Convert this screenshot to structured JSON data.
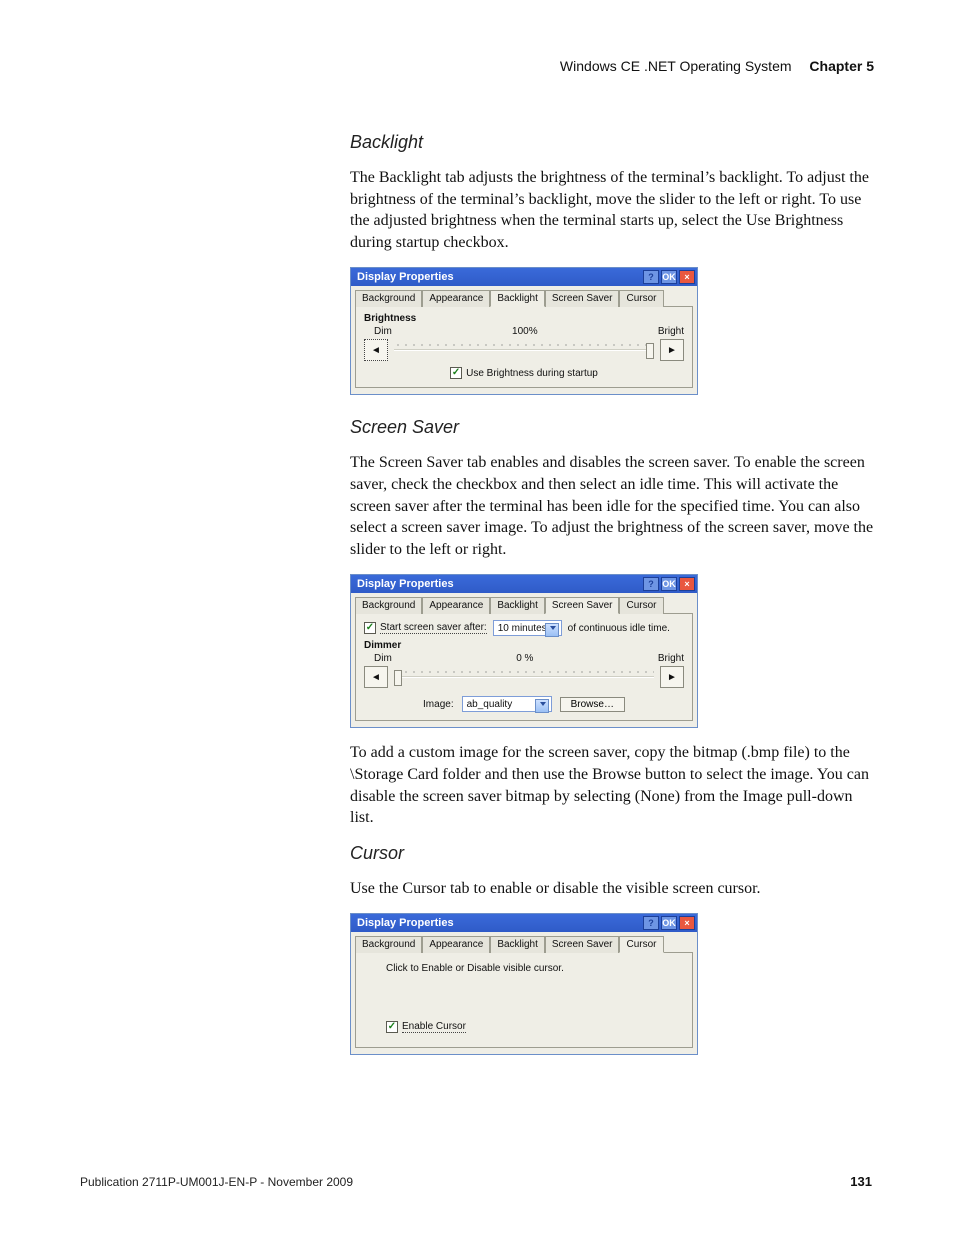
{
  "header": {
    "section": "Windows CE .NET Operating System",
    "chapter": "Chapter 5"
  },
  "backlight": {
    "heading": "Backlight",
    "para": "The Backlight tab adjusts the brightness of the terminal’s backlight. To adjust the brightness of the terminal’s backlight, move the slider to the left or right. To use the adjusted brightness when the terminal starts up, select the Use Brightness during startup checkbox.",
    "dlg": {
      "title": "Display Properties",
      "help": "?",
      "ok": "OK",
      "close": "×",
      "tabs": [
        "Background",
        "Appearance",
        "Backlight",
        "Screen Saver",
        "Cursor"
      ],
      "active_tab": 2,
      "group_label": "Brightness",
      "dim_label": "Dim",
      "bright_label": "Bright",
      "percent": "100%",
      "left_arrow": "◄",
      "right_arrow": "►",
      "checkbox_label": "Use Brightness during startup"
    }
  },
  "screensaver": {
    "heading": "Screen Saver",
    "para1": "The Screen Saver tab enables and disables the screen saver. To enable the screen saver, check the checkbox and then select an idle time. This will activate the screen saver after the terminal has been idle for the specified time. You can also select a screen saver image. To adjust the brightness of the screen saver, move the slider to the left or right.",
    "para2": "To add a custom image for the screen saver, copy the bitmap (.bmp file) to the \\Storage Card folder and then use the Browse button to select the image. You can disable the screen saver bitmap by selecting (None) from the Image pull-down list.",
    "dlg": {
      "title": "Display Properties",
      "help": "?",
      "ok": "OK",
      "close": "×",
      "tabs": [
        "Background",
        "Appearance",
        "Backlight",
        "Screen Saver",
        "Cursor"
      ],
      "active_tab": 3,
      "start_label": "Start screen saver after:",
      "idle_value": "10 minutes",
      "idle_suffix": "of continuous idle time.",
      "group_label": "Dimmer",
      "dim_label": "Dim",
      "bright_label": "Bright",
      "percent": "0 %",
      "left_arrow": "◄",
      "right_arrow": "►",
      "image_label": "Image:",
      "image_value": "ab_quality",
      "browse": "Browse…"
    }
  },
  "cursor": {
    "heading": "Cursor",
    "para": "Use the Cursor tab to enable or disable the visible screen cursor.",
    "dlg": {
      "title": "Display Properties",
      "help": "?",
      "ok": "OK",
      "close": "×",
      "tabs": [
        "Background",
        "Appearance",
        "Backlight",
        "Screen Saver",
        "Cursor"
      ],
      "active_tab": 4,
      "instruction": "Click to Enable or Disable visible cursor.",
      "checkbox_label": "Enable Cursor"
    }
  },
  "footer": {
    "pub": "Publication 2711P-UM001J-EN-P - November 2009",
    "page": "131"
  }
}
